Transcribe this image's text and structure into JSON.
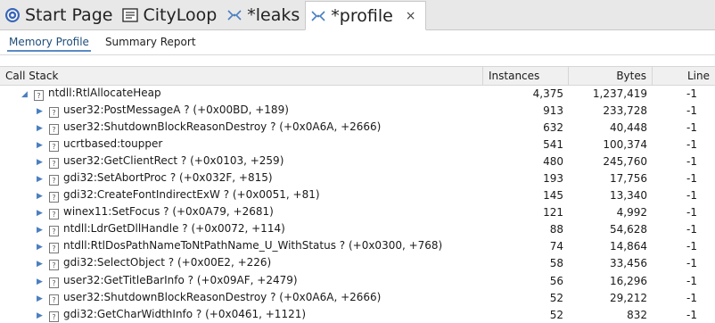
{
  "tabs": [
    {
      "label": "Start Page",
      "icon": "start-page-icon",
      "active": false
    },
    {
      "label": "CityLoop",
      "icon": "diagram-icon",
      "active": false
    },
    {
      "label": "*leaks",
      "icon": "profile-icon",
      "active": false
    },
    {
      "label": "*profile",
      "icon": "profile-icon",
      "active": true,
      "close": "×"
    }
  ],
  "subtabs": [
    {
      "label": "Memory Profile",
      "active": true
    },
    {
      "label": "Summary Report",
      "active": false
    }
  ],
  "columns": {
    "stack": "Call Stack",
    "instances": "Instances",
    "bytes": "Bytes",
    "line": "Line"
  },
  "rows": [
    {
      "name": "ntdll:RtlAllocateHeap",
      "instances": "4,375",
      "bytes": "1,237,419",
      "line": "-1",
      "expanded": true,
      "level": 0
    },
    {
      "name": "user32:PostMessageA ? (+0x00BD, +189)",
      "instances": "913",
      "bytes": "233,728",
      "line": "-1",
      "level": 1
    },
    {
      "name": "user32:ShutdownBlockReasonDestroy ? (+0x0A6A, +2666)",
      "instances": "632",
      "bytes": "40,448",
      "line": "-1",
      "level": 1
    },
    {
      "name": "ucrtbased:toupper",
      "instances": "541",
      "bytes": "100,374",
      "line": "-1",
      "level": 1
    },
    {
      "name": "user32:GetClientRect ? (+0x0103, +259)",
      "instances": "480",
      "bytes": "245,760",
      "line": "-1",
      "level": 1
    },
    {
      "name": "gdi32:SetAbortProc ? (+0x032F, +815)",
      "instances": "193",
      "bytes": "17,756",
      "line": "-1",
      "level": 1
    },
    {
      "name": "gdi32:CreateFontIndirectExW ? (+0x0051, +81)",
      "instances": "145",
      "bytes": "13,340",
      "line": "-1",
      "level": 1
    },
    {
      "name": "winex11:SetFocus ? (+0x0A79, +2681)",
      "instances": "121",
      "bytes": "4,992",
      "line": "-1",
      "level": 1
    },
    {
      "name": "ntdll:LdrGetDllHandle ? (+0x0072, +114)",
      "instances": "88",
      "bytes": "54,628",
      "line": "-1",
      "level": 1
    },
    {
      "name": "ntdll:RtlDosPathNameToNtPathName_U_WithStatus ? (+0x0300, +768)",
      "instances": "74",
      "bytes": "14,864",
      "line": "-1",
      "level": 1
    },
    {
      "name": "gdi32:SelectObject ? (+0x00E2, +226)",
      "instances": "58",
      "bytes": "33,456",
      "line": "-1",
      "level": 1
    },
    {
      "name": "user32:GetTitleBarInfo ? (+0x09AF, +2479)",
      "instances": "56",
      "bytes": "16,296",
      "line": "-1",
      "level": 1
    },
    {
      "name": "user32:ShutdownBlockReasonDestroy ? (+0x0A6A, +2666)",
      "instances": "52",
      "bytes": "29,212",
      "line": "-1",
      "level": 1
    },
    {
      "name": "gdi32:GetCharWidthInfo ? (+0x0461, +1121)",
      "instances": "52",
      "bytes": "832",
      "line": "-1",
      "level": 1
    }
  ],
  "colors": {
    "accent": "#5b8bc5",
    "arrow": "#4a7fbf",
    "tabbar": "#e8e8e8"
  }
}
